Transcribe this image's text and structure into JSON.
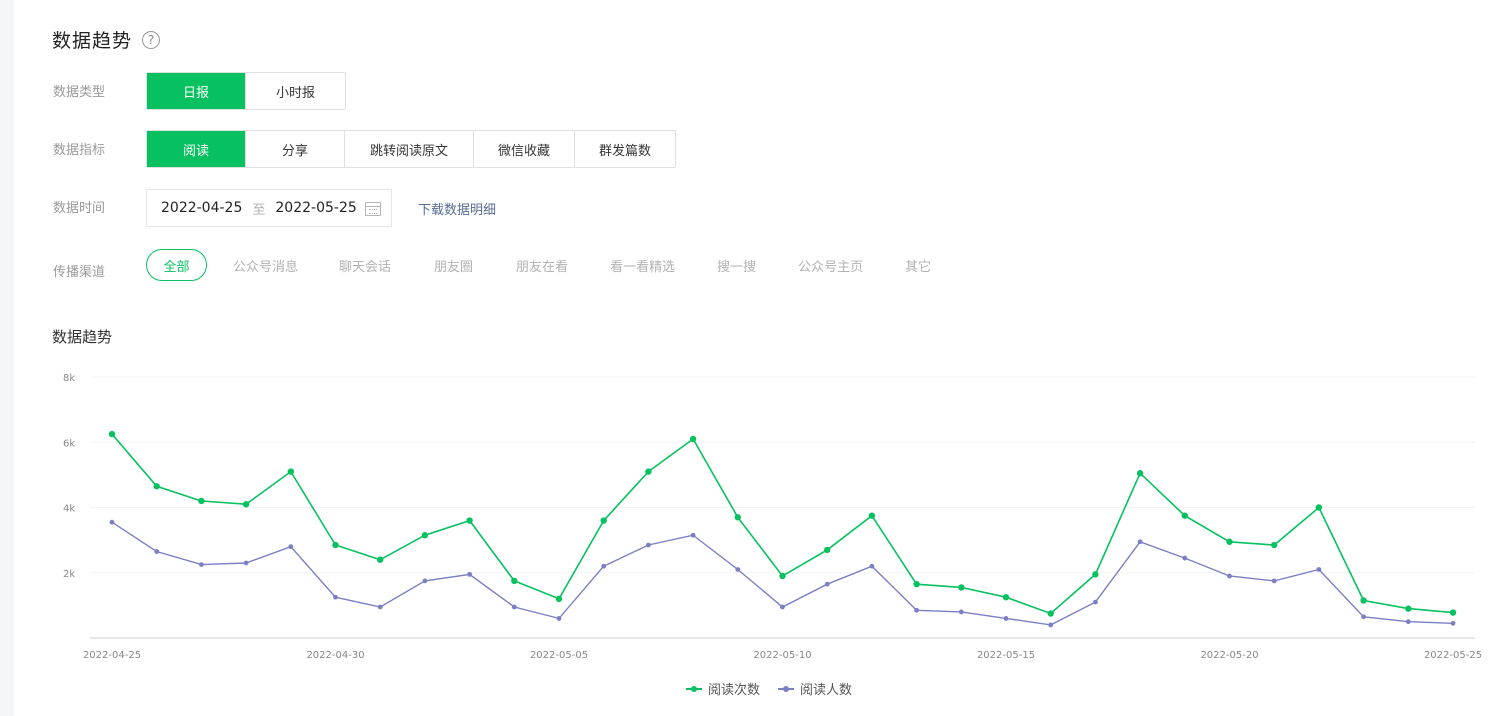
{
  "header": {
    "title": "数据趋势",
    "help_icon": "?"
  },
  "filters": {
    "type": {
      "label": "数据类型",
      "options": [
        "日报",
        "小时报"
      ],
      "selected": 0
    },
    "metric": {
      "label": "数据指标",
      "options": [
        "阅读",
        "分享",
        "跳转阅读原文",
        "微信收藏",
        "群发篇数"
      ],
      "selected": 0
    },
    "time": {
      "label": "数据时间",
      "start": "2022-04-25",
      "separator": "至",
      "end": "2022-05-25",
      "download": "下载数据明细"
    },
    "channel": {
      "label": "传播渠道",
      "options": [
        "全部",
        "公众号消息",
        "聊天会话",
        "朋友圈",
        "朋友在看",
        "看一看精选",
        "搜一搜",
        "公众号主页",
        "其它"
      ],
      "selected": 0
    }
  },
  "chart_section": {
    "title": "数据趋势"
  },
  "colors": {
    "accent": "#07c160",
    "series_reads": "#07c160",
    "series_readers": "#7b7fc4",
    "link": "#576b95"
  },
  "chart_data": {
    "type": "line",
    "x": [
      "2022-04-25",
      "2022-04-26",
      "2022-04-27",
      "2022-04-28",
      "2022-04-29",
      "2022-04-30",
      "2022-05-01",
      "2022-05-02",
      "2022-05-03",
      "2022-05-04",
      "2022-05-05",
      "2022-05-06",
      "2022-05-07",
      "2022-05-08",
      "2022-05-09",
      "2022-05-10",
      "2022-05-11",
      "2022-05-12",
      "2022-05-13",
      "2022-05-14",
      "2022-05-15",
      "2022-05-16",
      "2022-05-17",
      "2022-05-18",
      "2022-05-19",
      "2022-05-20",
      "2022-05-21",
      "2022-05-22",
      "2022-05-23",
      "2022-05-24",
      "2022-05-25"
    ],
    "x_tick_labels": [
      "2022-04-25",
      "2022-04-30",
      "2022-05-05",
      "2022-05-10",
      "2022-05-15",
      "2022-05-20",
      "2022-05-25"
    ],
    "y_ticks": [
      {
        "v": 2000,
        "label": "2k"
      },
      {
        "v": 4000,
        "label": "4k"
      },
      {
        "v": 6000,
        "label": "6k"
      },
      {
        "v": 8000,
        "label": "8k"
      }
    ],
    "ylim": [
      0,
      8000
    ],
    "series": [
      {
        "name": "阅读次数",
        "color": "#07c160",
        "values": [
          6250,
          4650,
          4200,
          4100,
          5100,
          2850,
          2400,
          3150,
          3600,
          1750,
          1200,
          3600,
          5100,
          6100,
          3700,
          1900,
          2700,
          3750,
          1650,
          1550,
          1250,
          750,
          1950,
          5050,
          3750,
          2950,
          2850,
          4000,
          1150,
          900,
          780
        ]
      },
      {
        "name": "阅读人数",
        "color": "#7b7fc4",
        "values": [
          3550,
          2650,
          2250,
          2300,
          2800,
          1250,
          950,
          1750,
          1950,
          950,
          600,
          2200,
          2850,
          3150,
          2100,
          950,
          1650,
          2200,
          850,
          800,
          600,
          400,
          1100,
          2950,
          2450,
          1900,
          1750,
          2100,
          650,
          500,
          450
        ]
      }
    ],
    "grid": "horizontal-light",
    "legend": "bottom-center"
  }
}
